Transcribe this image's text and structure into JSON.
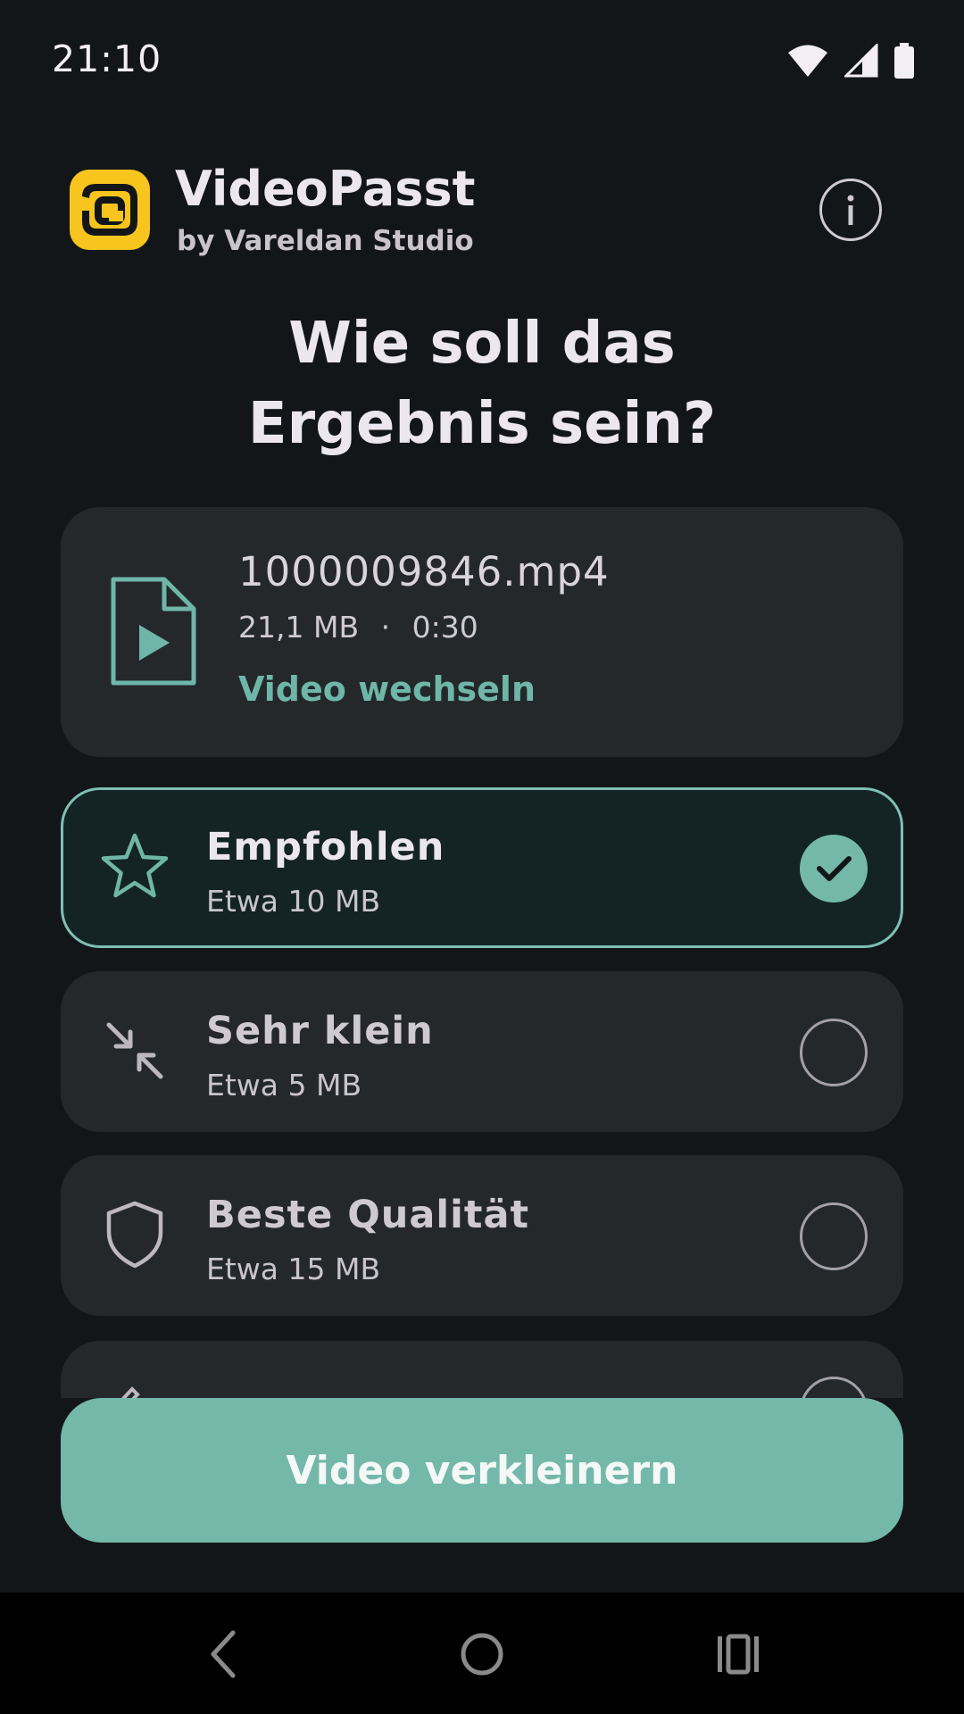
{
  "status_bar": {
    "time": "21:10",
    "icons": [
      "wifi-icon",
      "signal-icon",
      "battery-icon"
    ]
  },
  "header": {
    "app_title": "VideoPasst",
    "app_subtitle": "by Vareldan Studio",
    "logo_color": "#f7c51e",
    "info_icon": "info-icon"
  },
  "question": {
    "line1": "Wie soll das",
    "line2": "Ergebnis sein?"
  },
  "file": {
    "name": "1000009846.mp4",
    "size": "21,1 MB",
    "separator": "·",
    "duration": "0:30",
    "change_label": "Video wechseln"
  },
  "options": [
    {
      "icon": "star-icon",
      "title": "Empfohlen",
      "size": "Etwa 10 MB",
      "selected": true
    },
    {
      "icon": "compress-arrows-icon",
      "title": "Sehr klein",
      "size": "Etwa 5 MB",
      "selected": false
    },
    {
      "icon": "shield-icon",
      "title": "Beste Qualität",
      "size": "Etwa 15 MB",
      "selected": false
    }
  ],
  "primary_button": {
    "label": "Video verkleinern"
  },
  "colors": {
    "accent": "#74b8aa",
    "background": "#131618",
    "card": "#24282b"
  },
  "nav_bar": {
    "icons": [
      "back-icon",
      "home-icon",
      "recents-icon"
    ]
  }
}
